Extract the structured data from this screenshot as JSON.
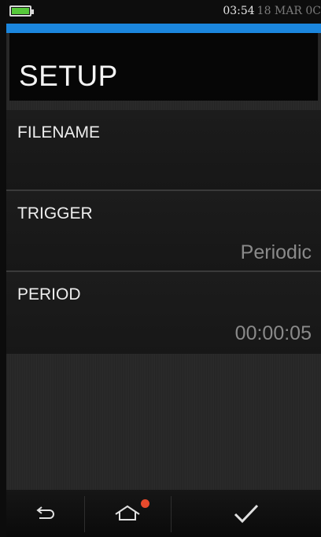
{
  "status": {
    "time": "03:54",
    "date": "18 MAR 0C",
    "battery_icon": "battery-full-icon"
  },
  "colors": {
    "accent": "#1b86dd",
    "battery": "#56c83a",
    "notification": "#e84a2c"
  },
  "page": {
    "title": "SETUP"
  },
  "settings": [
    {
      "label": "FILENAME",
      "value": ""
    },
    {
      "label": "TRIGGER",
      "value": "Periodic"
    },
    {
      "label": "PERIOD",
      "value": "00:00:05"
    }
  ],
  "navbar": {
    "back_icon": "back-arrow-icon",
    "home_icon": "home-icon",
    "confirm_icon": "checkmark-icon"
  }
}
